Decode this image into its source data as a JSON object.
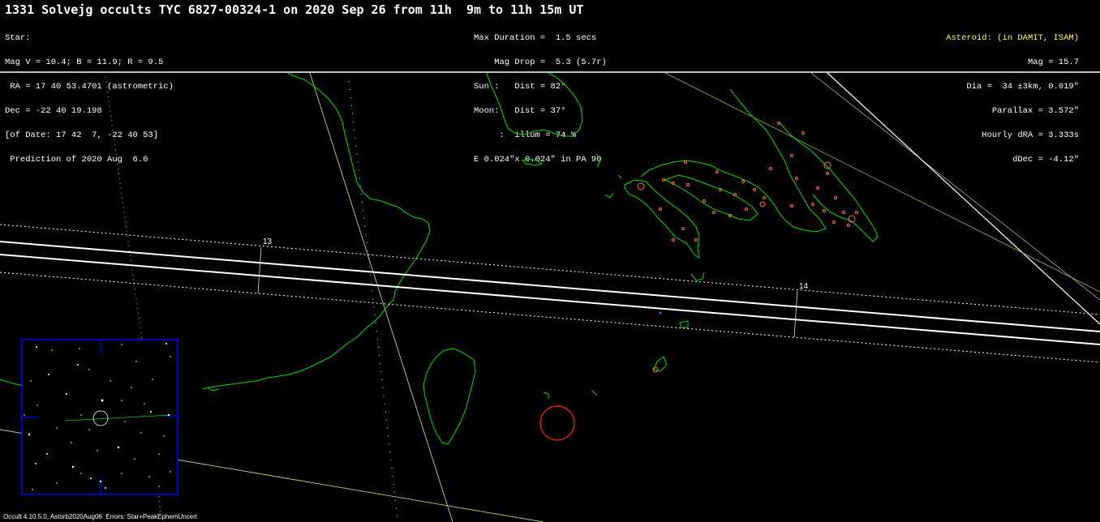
{
  "title": "1331 Solvejg occults TYC 6827-00324-1 on 2020 Sep 26 from 11h  9m to 11h 15m UT",
  "star": {
    "heading": "Star:",
    "mag": "Mag V = 10.4; B = 11.9; R = 9.5",
    "ra": " RA = 17 40 53.4701 (astrometric)",
    "dec": "Dec = -22 40 19.198",
    "of_date": "[of Date: 17 42  7, -22 40 53]",
    "prediction": " Prediction of 2020 Aug  6.0"
  },
  "event": {
    "max_duration": "Max Duration =  1.5 secs",
    "mag_drop": "    Mag Drop =  5.3 (5.7r)",
    "sun": "Sun :   Dist = 82°",
    "moon": "Moon:   Dist = 37°",
    "illum": "     :  illum = 74 %",
    "ellipse": "E 0.024\"x 0.024\" in PA 90"
  },
  "asteroid": {
    "heading": "Asteroid: (in DAMIT, ISAM)",
    "mag": "Mag = 15.7",
    "dia": "Dia =  34 ±3km, 0.019\"",
    "parallax": "Parallax = 3.572\"",
    "hourly_dra": "Hourly dRA = 3.333s",
    "ddec": "dDec = -4.12\""
  },
  "path_ticks": [
    "13",
    "14"
  ],
  "footer": "Occult 4.10.5.0, Astorb2020Aug06  Errors: Star+PeakEphemUncert",
  "colors": {
    "background": "#000000",
    "coastline": "#00cc00",
    "path": "#ffffff",
    "city": "#ff6633",
    "moon_circle": "#ff0000",
    "starchart_border": "#0000ff",
    "asteroid_label": "#ffff66"
  }
}
